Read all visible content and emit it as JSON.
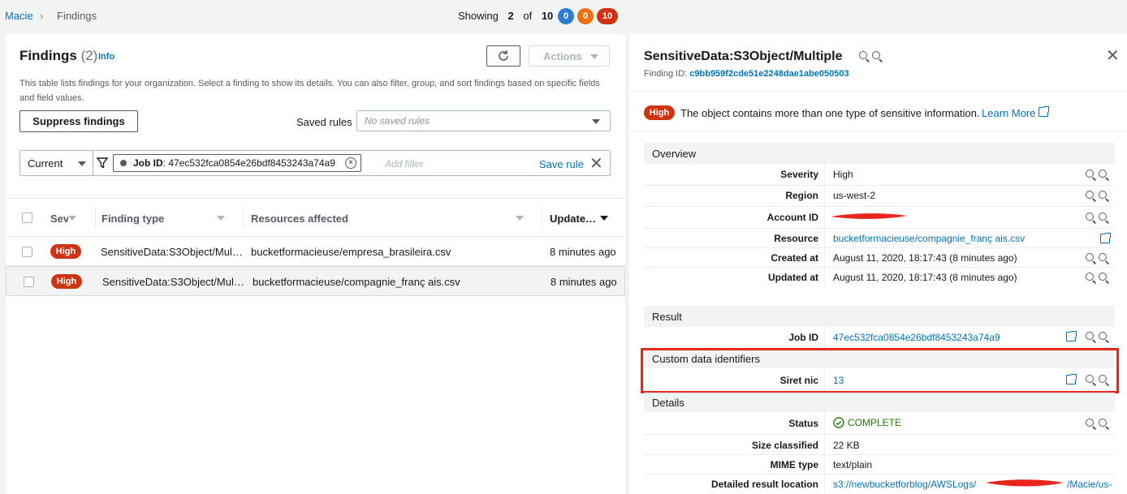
{
  "breadcrumb": {
    "root": "Macie",
    "current": "Findings"
  },
  "showing": {
    "label": "Showing",
    "count": "2",
    "of_label": "of",
    "total": "10"
  },
  "severity_counts": [
    {
      "value": "0",
      "color": "#2e7dd2"
    },
    {
      "value": "0",
      "color": "#ec7211"
    },
    {
      "value": "10",
      "color": "#d13212"
    }
  ],
  "findings_panel": {
    "title": "Findings",
    "count": "(2)",
    "info": "Info",
    "description": "This table lists findings for your organization. Select a finding to show its details. You can also filter, group, and sort findings based on specific fields and field values.",
    "actions_label": "Actions",
    "suppress_label": "Suppress findings",
    "saved_rules_label": "Saved rules",
    "saved_rules_placeholder": "No saved rules",
    "current_label": "Current",
    "filter_token": {
      "key": "Job ID",
      "value": ": 47ec532fca0854e26bdf8453243a74a9"
    },
    "add_filter_placeholder": "Add filter",
    "save_rule": "Save rule",
    "columns": [
      "Sev",
      "Finding type",
      "Resources affected",
      "Update…"
    ],
    "rows": [
      {
        "severity": "High",
        "type": "SensitiveData:S3Object/Mul…",
        "resource": "bucketformacieuse/empresa_brasileira.csv",
        "updated": "8 minutes ago"
      },
      {
        "severity": "High",
        "type": "SensitiveData:S3Object/Mul…",
        "resource": "bucketformacieuse/compagnie_franç ais.csv",
        "updated": "8 minutes ago"
      }
    ]
  },
  "detail": {
    "title": "SensitiveData:S3Object/Multiple",
    "finding_id_label": "Finding ID:",
    "finding_id": "c9bb959f2cde51e2248dae1abe050503",
    "severity_badge": "High",
    "summary": "The object contains more than one type of sensitive information.",
    "learn_more": "Learn More",
    "overview": {
      "heading": "Overview",
      "severity_label": "Severity",
      "severity": "High",
      "region_label": "Region",
      "region": "us-west-2",
      "account_label": "Account ID",
      "resource_label": "Resource",
      "resource": "bucketformacieuse/compagnie_franç ais.csv",
      "created_label": "Created at",
      "created": "August 11, 2020, 18:17:43 (8 minutes ago)",
      "updated_label": "Updated at",
      "updated": "August 11, 2020, 18:17:43 (8 minutes ago)"
    },
    "result": {
      "heading": "Result",
      "job_label": "Job ID",
      "job": "47ec532fca0854e26bdf8453243a74a9",
      "custom_heading": "Custom data identifiers",
      "siret_label": "Siret nic",
      "siret": "13"
    },
    "details": {
      "heading": "Details",
      "status_label": "Status",
      "status": "COMPLETE",
      "size_label": "Size classified",
      "size": "22 KB",
      "mime_label": "MIME type",
      "mime": "text/plain",
      "location_label": "Detailed result location",
      "location_start": "s3://newbucketforblog/AWSLogs/",
      "location_end": "/Macie/us-"
    }
  },
  "colors": {
    "accent": "#0073bb",
    "high": "#d13212",
    "highlight": "#e8261b",
    "success": "#1d8102"
  }
}
